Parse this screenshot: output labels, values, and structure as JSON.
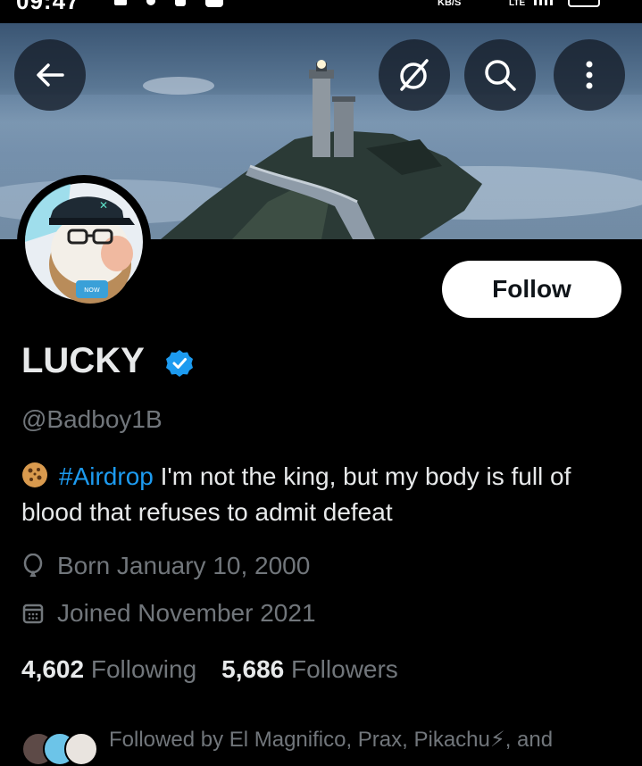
{
  "status_bar": {
    "time": "09:47",
    "speed_unit": "KB/S",
    "network": "LTE"
  },
  "profile": {
    "display_name": "LUCKY",
    "handle": "@Badboy1B",
    "bio": {
      "hashtag": "#Airdrop",
      "text": " I'm not the king, but my body is full of blood that refuses to admit defeat"
    },
    "born": "Born January 10, 2000",
    "joined": "Joined November 2021",
    "following_count": "4,602",
    "following_label": "Following",
    "followers_count": "5,686",
    "followers_label": "Followers",
    "followed_by": "Followed by El Magnifico, Prax, Pikachu⚡, and"
  },
  "actions": {
    "follow_label": "Follow"
  },
  "icons": {
    "back": "arrow-left-icon",
    "grok": "grok-icon",
    "search": "search-icon",
    "more": "more-vertical-icon",
    "verified": "verified-badge-icon",
    "birthday": "balloon-icon",
    "calendar": "calendar-icon",
    "cookie": "cookie-emoji"
  },
  "colors": {
    "accent": "#1d9bf0",
    "background": "#000000",
    "muted": "#71767b",
    "text": "#e7e9ea"
  }
}
